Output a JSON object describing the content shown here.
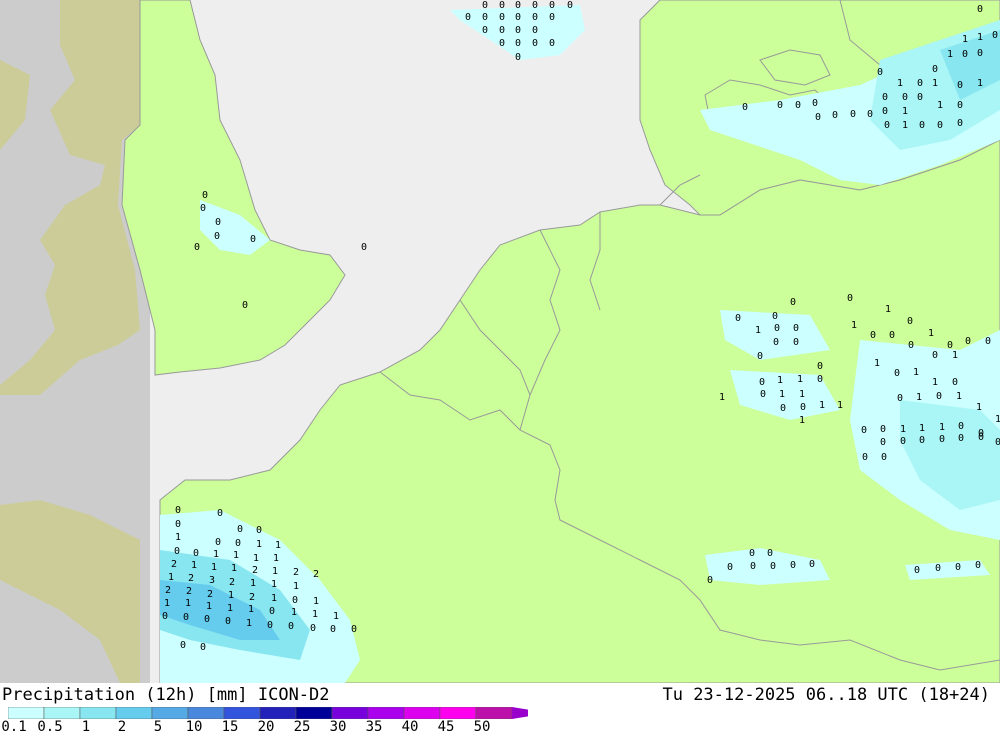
{
  "header": {
    "title_left": "Precipitation (12h) [mm] ICON-D2",
    "title_right": "Tu 23-12-2025 06..18 UTC (18+24)"
  },
  "colors": {
    "sea": "#eeeeee",
    "land_in_domain": "#ccff99",
    "land_outside": "#cccc99",
    "outside_sea": "#cccccc",
    "borders": "#999999"
  },
  "legend": {
    "ticks": [
      "0.1",
      "0.5",
      "1",
      "2",
      "5",
      "10",
      "15",
      "20",
      "25",
      "30",
      "35",
      "40",
      "45",
      "50"
    ],
    "colors": [
      "#ccffff",
      "#aaf5f5",
      "#88e6f0",
      "#66ccee",
      "#55aae6",
      "#4a88dd",
      "#3355dd",
      "#2222bb",
      "#000099",
      "#7700dd",
      "#aa00ee",
      "#dd00ee",
      "#ff00ee",
      "#bb11aa",
      "#9900cc"
    ]
  },
  "map_labels": {
    "north_sea_group": [
      "0",
      "0",
      "0",
      "0",
      "0",
      "0",
      "0",
      "0",
      "0",
      "0",
      "0",
      "0",
      "0",
      "0",
      "0",
      "0",
      "0",
      "0",
      "0",
      "0",
      "0"
    ],
    "denmark_group": [
      "0",
      "1",
      "1",
      "0",
      "1",
      "0",
      "0",
      "0",
      "0",
      "1",
      "0",
      "1",
      "0",
      "1",
      "0",
      "0",
      "0",
      "0",
      "1",
      "1",
      "0",
      "0",
      "0",
      "0",
      "0",
      "0",
      "0",
      "0",
      "0",
      "0",
      "1",
      "0",
      "0",
      "0"
    ],
    "england_group": [
      "0",
      "0",
      "0",
      "0",
      "0",
      "0",
      "0",
      "0"
    ],
    "channel_group": [
      "0",
      "0",
      "0",
      "0",
      "0",
      "1",
      "0",
      "0",
      "1",
      "1",
      "0",
      "0",
      "1",
      "1",
      "1",
      "1",
      "2",
      "1",
      "1",
      "1",
      "2",
      "1",
      "2",
      "2",
      "1",
      "2",
      "3",
      "2",
      "1",
      "1",
      "1",
      "2",
      "2",
      "2",
      "1",
      "2",
      "1",
      "0",
      "1",
      "1",
      "1",
      "1",
      "1",
      "1",
      "0",
      "1",
      "1",
      "1",
      "0",
      "0",
      "0",
      "0",
      "1",
      "0",
      "0",
      "0",
      "0",
      "0",
      "0",
      "0"
    ],
    "germany_group": [
      "0",
      "0",
      "0",
      "0",
      "1",
      "0",
      "1",
      "0",
      "0",
      "1",
      "0",
      "0",
      "0",
      "1",
      "0",
      "0",
      "0",
      "0",
      "0",
      "0",
      "0",
      "1",
      "0",
      "1",
      "0",
      "1",
      "1",
      "0",
      "0",
      "1",
      "1",
      "0",
      "1",
      "0",
      "1",
      "1",
      "0",
      "0",
      "1",
      "1",
      "1",
      "0",
      "1",
      "0",
      "1",
      "1",
      "1",
      "0",
      "0",
      "1",
      "1",
      "1",
      "0",
      "0",
      "0",
      "0",
      "0",
      "0",
      "0",
      "0",
      "0",
      "0",
      "0"
    ],
    "south_group": [
      "0",
      "0",
      "0",
      "0",
      "0",
      "0",
      "0",
      "0",
      "0",
      "0",
      "0",
      "0"
    ]
  }
}
